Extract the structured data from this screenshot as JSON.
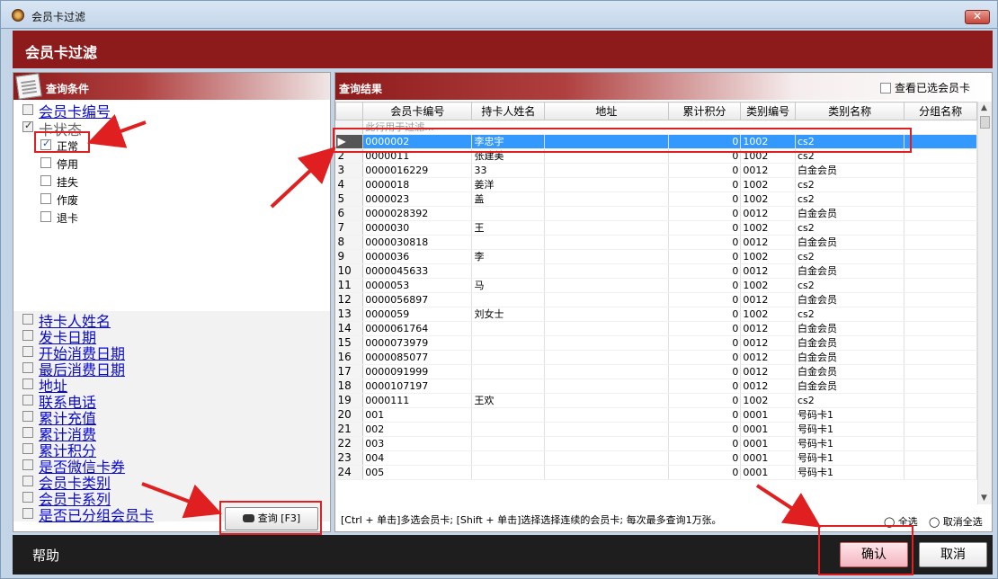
{
  "window": {
    "title": "会员卡过滤"
  },
  "header": {
    "title": "会员卡过滤"
  },
  "left_panel": {
    "title": "查询条件",
    "card_no": "会员卡编号",
    "card_status": "卡状态",
    "status_options": [
      {
        "label": "正常",
        "checked": true
      },
      {
        "label": "停用",
        "checked": false
      },
      {
        "label": "挂失",
        "checked": false
      },
      {
        "label": "作废",
        "checked": false
      },
      {
        "label": "退卡",
        "checked": false
      }
    ],
    "conditions": [
      "持卡人姓名",
      "发卡日期",
      "开始消费日期",
      "最后消费日期",
      "地址",
      "联系电话",
      "累计充值",
      "累计消费",
      "累计积分",
      "是否微信卡券",
      "会员卡类别",
      "会员卡系列",
      "是否已分组会员卡"
    ],
    "query_button": "查询 [F3]"
  },
  "right_panel": {
    "title": "查询结果",
    "view_selected": "查看已选会员卡",
    "columns": [
      "会员卡编号",
      "持卡人姓名",
      "地址",
      "累计积分",
      "类别编号",
      "类别名称",
      "分组名称"
    ],
    "filter_hint": "此行用于过滤...",
    "rows": [
      [
        "1",
        "0000002",
        "李忠宇",
        "",
        "0",
        "1002",
        "cs2",
        ""
      ],
      [
        "2",
        "0000011",
        "张建美",
        "",
        "0",
        "1002",
        "cs2",
        ""
      ],
      [
        "3",
        "0000016229",
        "33",
        "",
        "0",
        "0012",
        "白金会员",
        ""
      ],
      [
        "4",
        "0000018",
        "姜洋",
        "",
        "0",
        "1002",
        "cs2",
        ""
      ],
      [
        "5",
        "0000023",
        "盖",
        "",
        "0",
        "1002",
        "cs2",
        ""
      ],
      [
        "6",
        "0000028392",
        "",
        "",
        "0",
        "0012",
        "白金会员",
        ""
      ],
      [
        "7",
        "0000030",
        "王",
        "",
        "0",
        "1002",
        "cs2",
        ""
      ],
      [
        "8",
        "0000030818",
        "",
        "",
        "0",
        "0012",
        "白金会员",
        ""
      ],
      [
        "9",
        "0000036",
        "李",
        "",
        "0",
        "1002",
        "cs2",
        ""
      ],
      [
        "10",
        "0000045633",
        "",
        "",
        "0",
        "0012",
        "白金会员",
        ""
      ],
      [
        "11",
        "0000053",
        "马",
        "",
        "0",
        "1002",
        "cs2",
        ""
      ],
      [
        "12",
        "0000056897",
        "",
        "",
        "0",
        "0012",
        "白金会员",
        ""
      ],
      [
        "13",
        "0000059",
        "刘女士",
        "",
        "0",
        "1002",
        "cs2",
        ""
      ],
      [
        "14",
        "0000061764",
        "",
        "",
        "0",
        "0012",
        "白金会员",
        ""
      ],
      [
        "15",
        "0000073979",
        "",
        "",
        "0",
        "0012",
        "白金会员",
        ""
      ],
      [
        "16",
        "0000085077",
        "",
        "",
        "0",
        "0012",
        "白金会员",
        ""
      ],
      [
        "17",
        "0000091999",
        "",
        "",
        "0",
        "0012",
        "白金会员",
        ""
      ],
      [
        "18",
        "0000107197",
        "",
        "",
        "0",
        "0012",
        "白金会员",
        ""
      ],
      [
        "19",
        "0000111",
        "王欢",
        "",
        "0",
        "1002",
        "cs2",
        ""
      ],
      [
        "20",
        "001",
        "",
        "",
        "0",
        "0001",
        "号码卡1",
        ""
      ],
      [
        "21",
        "002",
        "",
        "",
        "0",
        "0001",
        "号码卡1",
        ""
      ],
      [
        "22",
        "003",
        "",
        "",
        "0",
        "0001",
        "号码卡1",
        ""
      ],
      [
        "23",
        "004",
        "",
        "",
        "0",
        "0001",
        "号码卡1",
        ""
      ],
      [
        "24",
        "005",
        "",
        "",
        "0",
        "0001",
        "号码卡1",
        ""
      ]
    ],
    "hint": "[Ctrl + 单击]多选会员卡; [Shift + 单击]选择选择连续的会员卡; 每次最多查询1万张。",
    "select_all": "全选",
    "deselect_all": "取消全选"
  },
  "footer": {
    "help": "帮助",
    "ok": "确认",
    "cancel": "取消"
  }
}
